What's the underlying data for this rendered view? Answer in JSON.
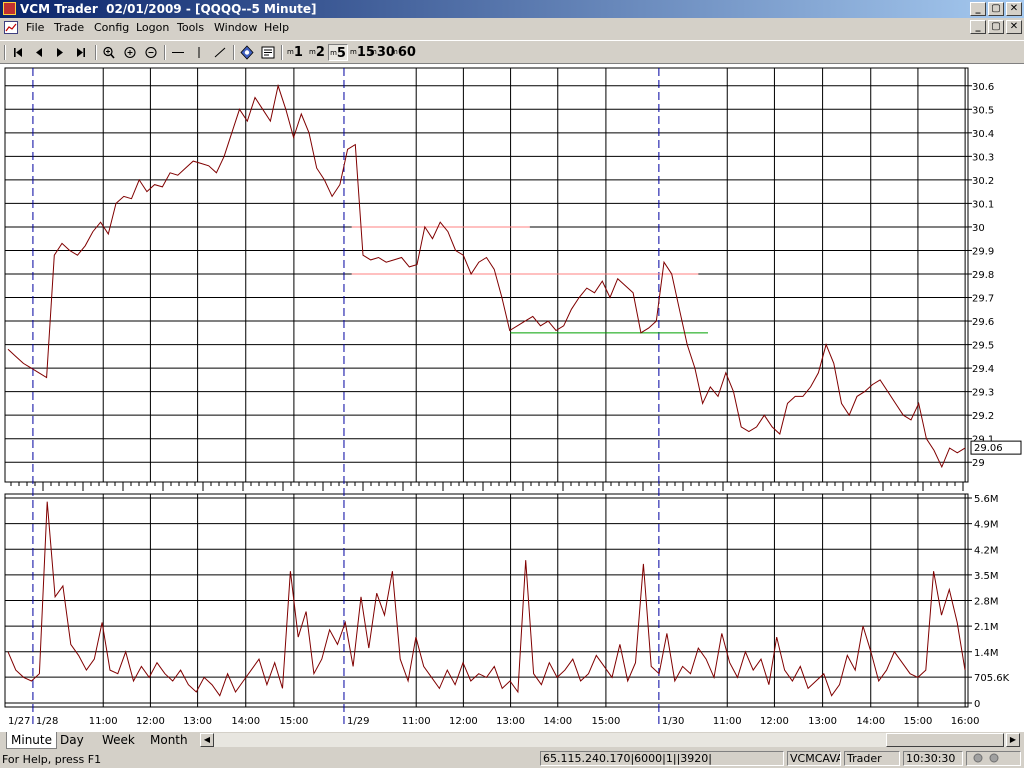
{
  "window": {
    "title": "VCM Trader  02/01/2009 - [QQQQ--5 Minute]",
    "minimize": "_",
    "maximize": "▢",
    "close": "✕"
  },
  "menu": {
    "items": [
      "File",
      "Trade",
      "Config",
      "Logon",
      "Tools",
      "Window",
      "Help"
    ]
  },
  "toolbar": {
    "nav_icons": [
      "first-icon",
      "prev-icon",
      "next-icon",
      "last-icon"
    ],
    "zoom_icons": [
      "zoom-in-icon",
      "zoom-plus-icon",
      "zoom-minus-icon"
    ],
    "draw_icons": [
      "horizontal-line-icon",
      "vertical-line-icon",
      "trend-line-icon"
    ],
    "other_icons": [
      "chart-settings-icon",
      "properties-icon"
    ],
    "intervals": [
      {
        "sup": "m",
        "label": "1"
      },
      {
        "sup": "m",
        "label": "2"
      },
      {
        "sup": "m",
        "label": "5"
      },
      {
        "sup": "m",
        "label": "15"
      },
      {
        "sup": "m",
        "label": "30"
      },
      {
        "sup": "m",
        "label": "60"
      }
    ],
    "active_interval": "5"
  },
  "chart_data": [
    {
      "type": "line",
      "name": "price",
      "ylim": [
        28.95,
        30.65
      ],
      "yticks": [
        "30.6",
        "30.5",
        "30.4",
        "30.3",
        "30.2",
        "30.1",
        "30",
        "29.9",
        "29.8",
        "29.7",
        "29.6",
        "29.5",
        "29.4",
        "29.3",
        "29.2",
        "29.1",
        "29"
      ],
      "yvalues": [
        30.6,
        30.5,
        30.4,
        30.3,
        30.2,
        30.1,
        30.0,
        29.9,
        29.8,
        29.7,
        29.6,
        29.5,
        29.4,
        29.3,
        29.2,
        29.1,
        29.0
      ],
      "current_price_label": "29.06",
      "current_price": 29.06,
      "line_color": "#800000",
      "grid": true,
      "values": [
        29.48,
        29.45,
        29.42,
        29.4,
        29.38,
        29.36,
        29.88,
        29.93,
        29.9,
        29.88,
        29.92,
        29.98,
        30.02,
        29.97,
        30.1,
        30.13,
        30.12,
        30.2,
        30.15,
        30.18,
        30.17,
        30.23,
        30.22,
        30.25,
        30.28,
        30.27,
        30.26,
        30.23,
        30.3,
        30.4,
        30.5,
        30.45,
        30.55,
        30.5,
        30.45,
        30.6,
        30.5,
        30.38,
        30.48,
        30.4,
        30.25,
        30.2,
        30.13,
        30.18,
        30.33,
        30.35,
        29.88,
        29.86,
        29.87,
        29.85,
        29.86,
        29.87,
        29.83,
        29.84,
        30.0,
        29.95,
        30.02,
        29.98,
        29.9,
        29.88,
        29.8,
        29.85,
        29.87,
        29.82,
        29.7,
        29.56,
        29.58,
        29.6,
        29.62,
        29.58,
        29.6,
        29.56,
        29.58,
        29.65,
        29.7,
        29.74,
        29.72,
        29.77,
        29.7,
        29.78,
        29.75,
        29.72,
        29.55,
        29.57,
        29.6,
        29.85,
        29.8,
        29.65,
        29.5,
        29.4,
        29.25,
        29.32,
        29.28,
        29.38,
        29.3,
        29.15,
        29.13,
        29.15,
        29.2,
        29.15,
        29.12,
        29.25,
        29.28,
        29.28,
        29.32,
        29.38,
        29.5,
        29.42,
        29.25,
        29.2,
        29.28,
        29.3,
        29.33,
        29.35,
        29.3,
        29.25,
        29.2,
        29.18,
        29.25,
        29.1,
        29.05,
        28.98,
        29.06,
        29.04,
        29.06
      ],
      "reference_lines": [
        {
          "value": 30.0,
          "color": "#ff8080",
          "x_from": 0.36,
          "x_to": 0.545
        },
        {
          "value": 29.8,
          "color": "#ff8080",
          "x_from": 0.36,
          "x_to": 0.72
        },
        {
          "value": 29.55,
          "color": "#00a000",
          "x_from": 0.525,
          "x_to": 0.73
        }
      ]
    },
    {
      "type": "bar",
      "name": "volume",
      "ylim": [
        0,
        5600000
      ],
      "yticks": [
        "5.6M",
        "4.9M",
        "4.2M",
        "3.5M",
        "2.8M",
        "2.1M",
        "1.4M",
        "705.6K",
        "0"
      ],
      "yvalues": [
        5600000,
        4900000,
        4200000,
        3500000,
        2800000,
        2100000,
        1400000,
        705600,
        0
      ],
      "line_color": "#800000",
      "values": [
        1.4,
        0.9,
        0.7,
        0.6,
        0.8,
        5.5,
        2.9,
        3.2,
        1.6,
        1.3,
        0.9,
        1.2,
        2.2,
        0.9,
        0.8,
        1.4,
        0.6,
        1.0,
        0.7,
        1.1,
        0.8,
        0.6,
        0.9,
        0.5,
        0.3,
        0.7,
        0.5,
        0.2,
        0.8,
        0.3,
        0.6,
        0.9,
        1.2,
        0.5,
        1.1,
        0.4,
        3.6,
        1.8,
        2.5,
        0.8,
        1.2,
        2.0,
        1.6,
        2.2,
        1.0,
        2.9,
        1.5,
        3.0,
        2.4,
        3.6,
        1.2,
        0.6,
        1.8,
        1.0,
        0.7,
        0.4,
        0.9,
        0.5,
        1.1,
        0.6,
        0.8,
        0.7,
        1.0,
        0.4,
        0.6,
        0.3,
        3.9,
        0.8,
        0.5,
        1.1,
        0.7,
        0.9,
        1.2,
        0.6,
        0.8,
        1.3,
        1.0,
        0.7,
        1.6,
        0.6,
        1.1,
        3.8,
        1.0,
        0.8,
        1.9,
        0.6,
        1.0,
        0.8,
        1.5,
        1.2,
        0.7,
        1.9,
        1.1,
        0.7,
        1.4,
        0.9,
        1.2,
        0.5,
        1.8,
        0.9,
        0.6,
        1.0,
        0.4,
        0.6,
        0.8,
        0.2,
        0.5,
        1.3,
        0.9,
        2.1,
        1.4,
        0.6,
        0.9,
        1.4,
        1.1,
        0.8,
        0.7,
        0.9,
        3.6,
        2.4,
        3.1,
        2.2,
        0.9
      ]
    }
  ],
  "x_axis": {
    "date_labels": [
      "1/27",
      "1/28",
      "1/29",
      "1/30"
    ],
    "date_positions": [
      0.0,
      0.029,
      0.352,
      0.679
    ],
    "time_labels": [
      "11:00",
      "12:00",
      "13:00",
      "14:00",
      "15:00",
      "11:00",
      "12:00",
      "13:00",
      "14:00",
      "15:00",
      "11:00",
      "12:00",
      "13:00",
      "14:00",
      "15:00",
      "16:00"
    ],
    "time_positions": [
      0.102,
      0.151,
      0.2,
      0.25,
      0.3,
      0.427,
      0.476,
      0.525,
      0.574,
      0.624,
      0.75,
      0.799,
      0.849,
      0.899,
      0.948,
      0.997
    ],
    "session_breaks": [
      0.029,
      0.352,
      0.679
    ]
  },
  "tabs": [
    "Minute",
    "Day",
    "Week",
    "Month"
  ],
  "active_tab": "Minute",
  "status": {
    "help": "For Help, press F1",
    "connection": "65.115.240.170|6000|1||3920|",
    "account": "VCMCAVAL",
    "role": "Trader",
    "time": "10:30:30"
  }
}
